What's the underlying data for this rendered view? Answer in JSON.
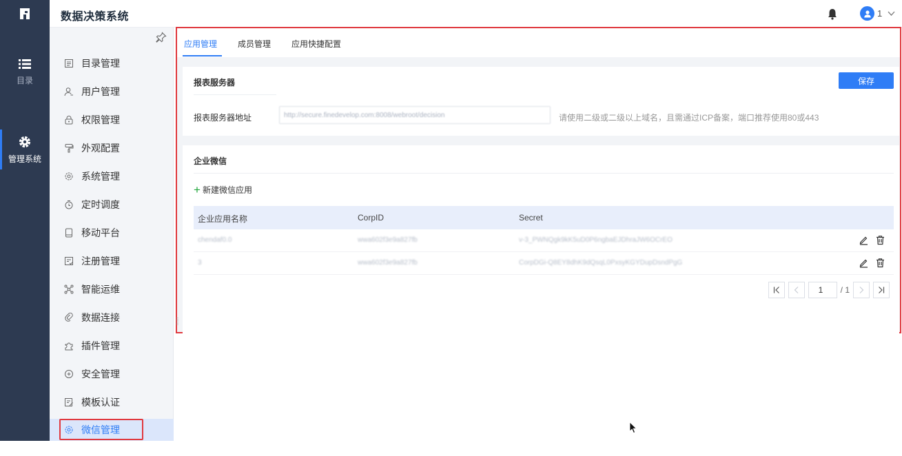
{
  "header": {
    "app_title": "数据决策系统",
    "user_name": "1",
    "icons": [
      "app-logo-icon",
      "bell-icon",
      "user-icon",
      "chevron-down-icon"
    ]
  },
  "left_nav": {
    "items": [
      {
        "label": "目录",
        "icon": "list-icon",
        "active": false
      },
      {
        "label": "管理系统",
        "icon": "gear-icon",
        "active": true
      }
    ]
  },
  "submenu": {
    "pin_icon": "pin-icon",
    "items": [
      {
        "label": "目录管理",
        "icon": "directory-icon"
      },
      {
        "label": "用户管理",
        "icon": "user-manage-icon"
      },
      {
        "label": "权限管理",
        "icon": "lock-icon"
      },
      {
        "label": "外观配置",
        "icon": "paint-roller-icon"
      },
      {
        "label": "系统管理",
        "icon": "system-gear-icon"
      },
      {
        "label": "定时调度",
        "icon": "timer-icon"
      },
      {
        "label": "移动平台",
        "icon": "mobile-icon"
      },
      {
        "label": "注册管理",
        "icon": "register-icon"
      },
      {
        "label": "智能运维",
        "icon": "operations-icon"
      },
      {
        "label": "数据连接",
        "icon": "link-icon"
      },
      {
        "label": "插件管理",
        "icon": "plugin-icon"
      },
      {
        "label": "安全管理",
        "icon": "shield-icon"
      },
      {
        "label": "模板认证",
        "icon": "template-icon"
      },
      {
        "label": "微信管理",
        "icon": "wechat-gear-icon",
        "active": true
      }
    ]
  },
  "tabs": [
    {
      "label": "应用管理",
      "active": true
    },
    {
      "label": "成员管理",
      "active": false
    },
    {
      "label": "应用快捷配置",
      "active": false
    }
  ],
  "report_server": {
    "title": "报表服务器",
    "save_label": "保存",
    "address_label": "报表服务器地址",
    "address_value": "http://secure.finedevelop.com:8008/webroot/decision",
    "hint": "请使用二级或二级以上域名，且需通过ICP备案，端口推荐使用80或443"
  },
  "wechat": {
    "title": "企业微信",
    "add_label": "新建微信应用",
    "columns": [
      "企业应用名称",
      "CorpID",
      "Secret"
    ],
    "rows": [
      {
        "name": "chendaf0.0",
        "corpid": "wwa602f3e9a827fb",
        "secret": "v-3_PWNQgk9kK5uD0P6ngbaEJDhraJW6OCrEO"
      },
      {
        "name": "3",
        "corpid": "wwa602f3e9a827fb",
        "secret": "CorpDGi-Q8EY8dhK9dQsqL0PxsyKGYDupDsndPgG"
      }
    ],
    "row_icons": [
      "edit-icon",
      "trash-icon"
    ],
    "pager": {
      "current": "1",
      "total": "/ 1"
    }
  }
}
